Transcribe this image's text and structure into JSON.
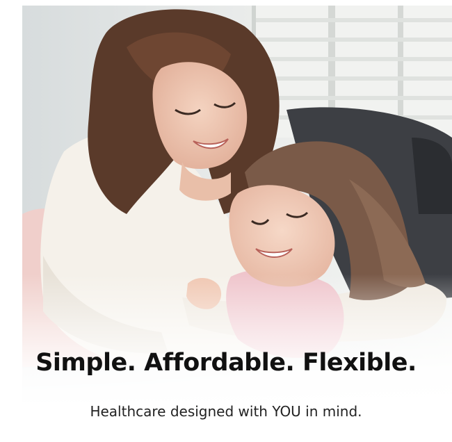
{
  "ad": {
    "headline": "Simple. Affordable. Flexible.",
    "subline": "Healthcare designed with YOU in mind."
  },
  "colors": {
    "headline_text": "#111111",
    "subline_text": "#222222",
    "background": "#ffffff"
  }
}
